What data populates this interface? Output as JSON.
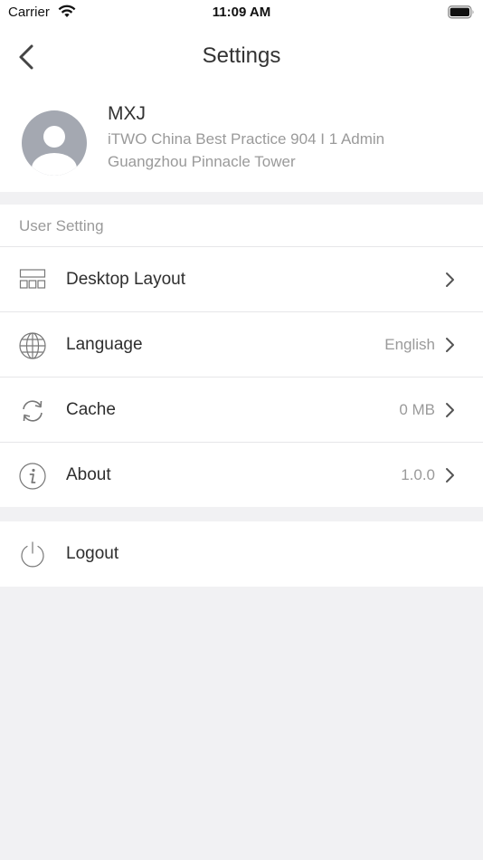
{
  "status_bar": {
    "carrier": "Carrier",
    "time": "11:09 AM",
    "wifi_icon": "wifi-icon",
    "battery_icon": "battery-icon"
  },
  "nav": {
    "title": "Settings",
    "back_icon": "chevron-left-icon"
  },
  "profile": {
    "name": "MXJ",
    "company": "iTWO China Best Practice 904 I 1 Admin",
    "location": "Guangzhou Pinnacle Tower",
    "avatar_icon": "user-avatar-icon"
  },
  "user_setting": {
    "header": "User Setting",
    "items": [
      {
        "label": "Desktop Layout",
        "value": "",
        "icon": "layout-grid-icon"
      },
      {
        "label": "Language",
        "value": "English",
        "icon": "globe-icon"
      },
      {
        "label": "Cache",
        "value": "0 MB",
        "icon": "sync-icon"
      },
      {
        "label": "About",
        "value": "1.0.0",
        "icon": "info-icon"
      }
    ]
  },
  "logout": {
    "label": "Logout",
    "icon": "power-icon"
  },
  "colors": {
    "background": "#f1f1f3",
    "surface": "#ffffff",
    "primary_text": "#2e2e2e",
    "secondary_text": "#9a9a9a",
    "divider": "#e6e6e8",
    "avatar": "#a4a8b1"
  }
}
